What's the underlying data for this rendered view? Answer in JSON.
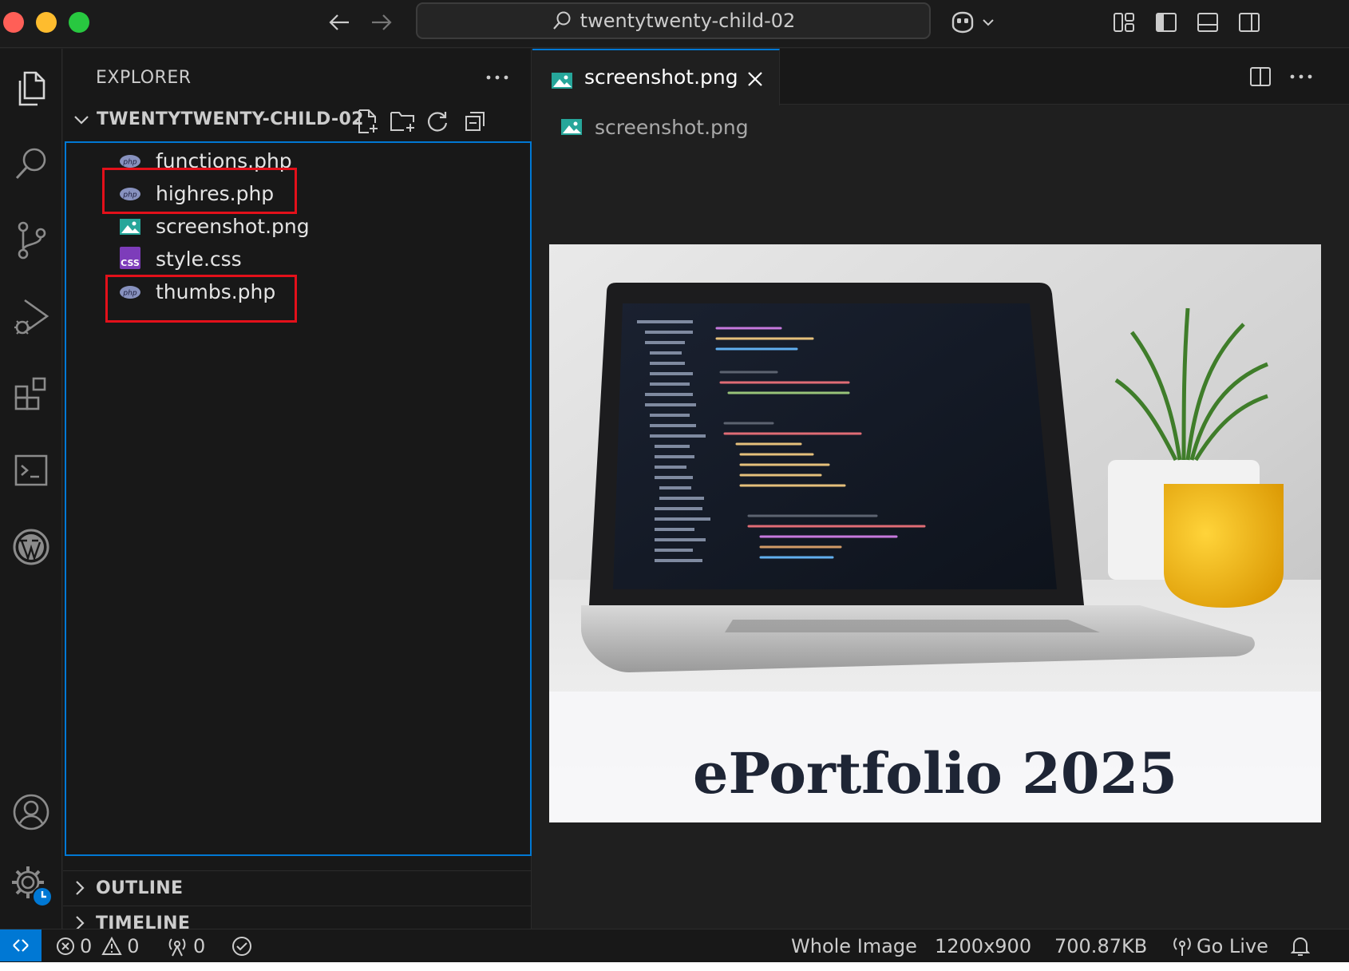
{
  "window": {
    "title": "twentytwenty-child-02",
    "nav_back_icon": "arrow-left-icon",
    "nav_forward_icon": "arrow-right-icon"
  },
  "activity_bar": {
    "items": [
      "explorer-icon",
      "search-icon",
      "source-control-icon",
      "run-debug-icon",
      "extensions-icon",
      "terminal-icon",
      "wordpress-icon"
    ],
    "bottom": [
      "accounts-icon",
      "manage-gear-icon"
    ]
  },
  "sidebar": {
    "title": "EXPLORER",
    "folder": "TWENTYTWENTY-CHILD-02",
    "files": [
      {
        "name": "functions.php",
        "type": "php",
        "highlighted": false
      },
      {
        "name": "highres.php",
        "type": "php",
        "highlighted": true
      },
      {
        "name": "screenshot.png",
        "type": "image",
        "highlighted": false
      },
      {
        "name": "style.css",
        "type": "css",
        "highlighted": false
      },
      {
        "name": "thumbs.php",
        "type": "php",
        "highlighted": true
      }
    ],
    "php_icon_text": "php",
    "css_icon_text": "CSS",
    "outline_label": "OUTLINE",
    "timeline_label": "TIMELINE"
  },
  "editor": {
    "active_tab": "screenshot.png",
    "breadcrumb": "screenshot.png",
    "preview_caption": "ePortfolio 2025"
  },
  "status_bar": {
    "errors": "0",
    "warnings": "0",
    "ports": "0",
    "selection": "Whole Image",
    "dimensions": "1200x900",
    "file_size": "700.87KB",
    "go_live": "Go Live"
  },
  "colors": {
    "accent": "#0078d4",
    "highlight_box": "#e3101a",
    "background": "#1f1f1f",
    "sidebar": "#181818"
  }
}
